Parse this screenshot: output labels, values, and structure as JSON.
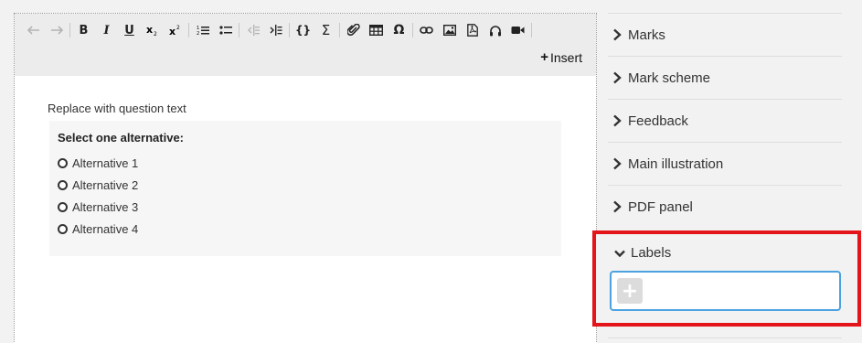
{
  "toolbar": {
    "buttons": [
      {
        "name": "undo-icon",
        "disabled": true
      },
      {
        "name": "redo-icon",
        "disabled": true
      },
      {
        "name": "bold-icon",
        "label": "B"
      },
      {
        "name": "italic-icon",
        "label": "I"
      },
      {
        "name": "underline-icon",
        "label": "U"
      },
      {
        "name": "subscript-icon"
      },
      {
        "name": "superscript-icon"
      },
      {
        "name": "numbered-list-icon"
      },
      {
        "name": "bullet-list-icon"
      },
      {
        "name": "outdent-icon",
        "disabled": true
      },
      {
        "name": "indent-icon"
      },
      {
        "name": "code-braces-icon",
        "label": "{}"
      },
      {
        "name": "sigma-icon",
        "label": "Σ"
      },
      {
        "name": "attachment-icon"
      },
      {
        "name": "table-icon"
      },
      {
        "name": "omega-icon",
        "label": "Ω"
      },
      {
        "name": "link-icon"
      },
      {
        "name": "image-icon"
      },
      {
        "name": "pdf-icon"
      },
      {
        "name": "audio-icon"
      },
      {
        "name": "video-icon"
      }
    ],
    "insert_label": "Insert"
  },
  "editor": {
    "question_text": "Replace with question text",
    "alternatives_heading": "Select one alternative:",
    "alternatives": [
      "Alternative 1",
      "Alternative 2",
      "Alternative 3",
      "Alternative 4"
    ]
  },
  "sidebar": {
    "items": [
      {
        "label": "Marks"
      },
      {
        "label": "Mark scheme"
      },
      {
        "label": "Feedback"
      },
      {
        "label": "Main illustration"
      },
      {
        "label": "PDF panel"
      }
    ],
    "labels_section": {
      "label": "Labels",
      "add_symbol": "+"
    }
  },
  "colors": {
    "highlight": "#e4141b",
    "field_border": "#4aa3e0"
  }
}
